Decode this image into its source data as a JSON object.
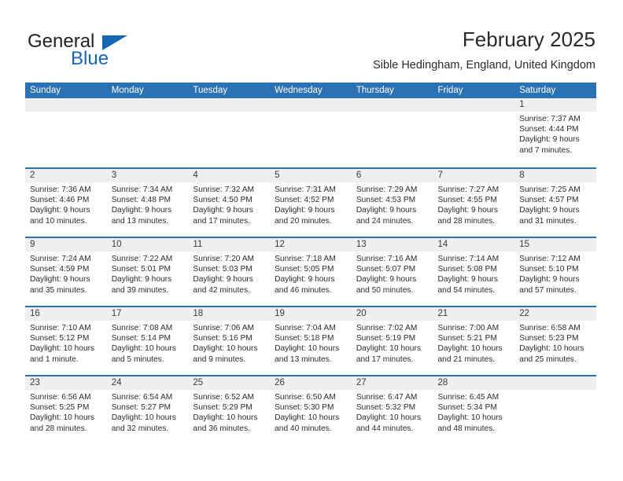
{
  "brand": {
    "name_part1": "General",
    "name_part2": "Blue",
    "triangle_color": "#1567b2"
  },
  "header": {
    "title": "February 2025",
    "subtitle": "Sible Hedingham, England, United Kingdom"
  },
  "theme": {
    "header_blue": "#2b72b4",
    "daynum_band": "#efefef",
    "text": "#2b2b2b"
  },
  "weekday_headers": [
    "Sunday",
    "Monday",
    "Tuesday",
    "Wednesday",
    "Thursday",
    "Friday",
    "Saturday"
  ],
  "weeks": [
    [
      {
        "day": "",
        "sunrise": "",
        "sunset": "",
        "daylight_line1": "",
        "daylight_line2": "",
        "empty": true
      },
      {
        "day": "",
        "sunrise": "",
        "sunset": "",
        "daylight_line1": "",
        "daylight_line2": "",
        "empty": true
      },
      {
        "day": "",
        "sunrise": "",
        "sunset": "",
        "daylight_line1": "",
        "daylight_line2": "",
        "empty": true
      },
      {
        "day": "",
        "sunrise": "",
        "sunset": "",
        "daylight_line1": "",
        "daylight_line2": "",
        "empty": true
      },
      {
        "day": "",
        "sunrise": "",
        "sunset": "",
        "daylight_line1": "",
        "daylight_line2": "",
        "empty": true
      },
      {
        "day": "",
        "sunrise": "",
        "sunset": "",
        "daylight_line1": "",
        "daylight_line2": "",
        "empty": true
      },
      {
        "day": "1",
        "sunrise": "Sunrise: 7:37 AM",
        "sunset": "Sunset: 4:44 PM",
        "daylight_line1": "Daylight: 9 hours",
        "daylight_line2": "and 7 minutes.",
        "empty": false
      }
    ],
    [
      {
        "day": "2",
        "sunrise": "Sunrise: 7:36 AM",
        "sunset": "Sunset: 4:46 PM",
        "daylight_line1": "Daylight: 9 hours",
        "daylight_line2": "and 10 minutes.",
        "empty": false
      },
      {
        "day": "3",
        "sunrise": "Sunrise: 7:34 AM",
        "sunset": "Sunset: 4:48 PM",
        "daylight_line1": "Daylight: 9 hours",
        "daylight_line2": "and 13 minutes.",
        "empty": false
      },
      {
        "day": "4",
        "sunrise": "Sunrise: 7:32 AM",
        "sunset": "Sunset: 4:50 PM",
        "daylight_line1": "Daylight: 9 hours",
        "daylight_line2": "and 17 minutes.",
        "empty": false
      },
      {
        "day": "5",
        "sunrise": "Sunrise: 7:31 AM",
        "sunset": "Sunset: 4:52 PM",
        "daylight_line1": "Daylight: 9 hours",
        "daylight_line2": "and 20 minutes.",
        "empty": false
      },
      {
        "day": "6",
        "sunrise": "Sunrise: 7:29 AM",
        "sunset": "Sunset: 4:53 PM",
        "daylight_line1": "Daylight: 9 hours",
        "daylight_line2": "and 24 minutes.",
        "empty": false
      },
      {
        "day": "7",
        "sunrise": "Sunrise: 7:27 AM",
        "sunset": "Sunset: 4:55 PM",
        "daylight_line1": "Daylight: 9 hours",
        "daylight_line2": "and 28 minutes.",
        "empty": false
      },
      {
        "day": "8",
        "sunrise": "Sunrise: 7:25 AM",
        "sunset": "Sunset: 4:57 PM",
        "daylight_line1": "Daylight: 9 hours",
        "daylight_line2": "and 31 minutes.",
        "empty": false
      }
    ],
    [
      {
        "day": "9",
        "sunrise": "Sunrise: 7:24 AM",
        "sunset": "Sunset: 4:59 PM",
        "daylight_line1": "Daylight: 9 hours",
        "daylight_line2": "and 35 minutes.",
        "empty": false
      },
      {
        "day": "10",
        "sunrise": "Sunrise: 7:22 AM",
        "sunset": "Sunset: 5:01 PM",
        "daylight_line1": "Daylight: 9 hours",
        "daylight_line2": "and 39 minutes.",
        "empty": false
      },
      {
        "day": "11",
        "sunrise": "Sunrise: 7:20 AM",
        "sunset": "Sunset: 5:03 PM",
        "daylight_line1": "Daylight: 9 hours",
        "daylight_line2": "and 42 minutes.",
        "empty": false
      },
      {
        "day": "12",
        "sunrise": "Sunrise: 7:18 AM",
        "sunset": "Sunset: 5:05 PM",
        "daylight_line1": "Daylight: 9 hours",
        "daylight_line2": "and 46 minutes.",
        "empty": false
      },
      {
        "day": "13",
        "sunrise": "Sunrise: 7:16 AM",
        "sunset": "Sunset: 5:07 PM",
        "daylight_line1": "Daylight: 9 hours",
        "daylight_line2": "and 50 minutes.",
        "empty": false
      },
      {
        "day": "14",
        "sunrise": "Sunrise: 7:14 AM",
        "sunset": "Sunset: 5:08 PM",
        "daylight_line1": "Daylight: 9 hours",
        "daylight_line2": "and 54 minutes.",
        "empty": false
      },
      {
        "day": "15",
        "sunrise": "Sunrise: 7:12 AM",
        "sunset": "Sunset: 5:10 PM",
        "daylight_line1": "Daylight: 9 hours",
        "daylight_line2": "and 57 minutes.",
        "empty": false
      }
    ],
    [
      {
        "day": "16",
        "sunrise": "Sunrise: 7:10 AM",
        "sunset": "Sunset: 5:12 PM",
        "daylight_line1": "Daylight: 10 hours",
        "daylight_line2": "and 1 minute.",
        "empty": false
      },
      {
        "day": "17",
        "sunrise": "Sunrise: 7:08 AM",
        "sunset": "Sunset: 5:14 PM",
        "daylight_line1": "Daylight: 10 hours",
        "daylight_line2": "and 5 minutes.",
        "empty": false
      },
      {
        "day": "18",
        "sunrise": "Sunrise: 7:06 AM",
        "sunset": "Sunset: 5:16 PM",
        "daylight_line1": "Daylight: 10 hours",
        "daylight_line2": "and 9 minutes.",
        "empty": false
      },
      {
        "day": "19",
        "sunrise": "Sunrise: 7:04 AM",
        "sunset": "Sunset: 5:18 PM",
        "daylight_line1": "Daylight: 10 hours",
        "daylight_line2": "and 13 minutes.",
        "empty": false
      },
      {
        "day": "20",
        "sunrise": "Sunrise: 7:02 AM",
        "sunset": "Sunset: 5:19 PM",
        "daylight_line1": "Daylight: 10 hours",
        "daylight_line2": "and 17 minutes.",
        "empty": false
      },
      {
        "day": "21",
        "sunrise": "Sunrise: 7:00 AM",
        "sunset": "Sunset: 5:21 PM",
        "daylight_line1": "Daylight: 10 hours",
        "daylight_line2": "and 21 minutes.",
        "empty": false
      },
      {
        "day": "22",
        "sunrise": "Sunrise: 6:58 AM",
        "sunset": "Sunset: 5:23 PM",
        "daylight_line1": "Daylight: 10 hours",
        "daylight_line2": "and 25 minutes.",
        "empty": false
      }
    ],
    [
      {
        "day": "23",
        "sunrise": "Sunrise: 6:56 AM",
        "sunset": "Sunset: 5:25 PM",
        "daylight_line1": "Daylight: 10 hours",
        "daylight_line2": "and 28 minutes.",
        "empty": false
      },
      {
        "day": "24",
        "sunrise": "Sunrise: 6:54 AM",
        "sunset": "Sunset: 5:27 PM",
        "daylight_line1": "Daylight: 10 hours",
        "daylight_line2": "and 32 minutes.",
        "empty": false
      },
      {
        "day": "25",
        "sunrise": "Sunrise: 6:52 AM",
        "sunset": "Sunset: 5:29 PM",
        "daylight_line1": "Daylight: 10 hours",
        "daylight_line2": "and 36 minutes.",
        "empty": false
      },
      {
        "day": "26",
        "sunrise": "Sunrise: 6:50 AM",
        "sunset": "Sunset: 5:30 PM",
        "daylight_line1": "Daylight: 10 hours",
        "daylight_line2": "and 40 minutes.",
        "empty": false
      },
      {
        "day": "27",
        "sunrise": "Sunrise: 6:47 AM",
        "sunset": "Sunset: 5:32 PM",
        "daylight_line1": "Daylight: 10 hours",
        "daylight_line2": "and 44 minutes.",
        "empty": false
      },
      {
        "day": "28",
        "sunrise": "Sunrise: 6:45 AM",
        "sunset": "Sunset: 5:34 PM",
        "daylight_line1": "Daylight: 10 hours",
        "daylight_line2": "and 48 minutes.",
        "empty": false
      },
      {
        "day": "",
        "sunrise": "",
        "sunset": "",
        "daylight_line1": "",
        "daylight_line2": "",
        "empty": true
      }
    ]
  ]
}
